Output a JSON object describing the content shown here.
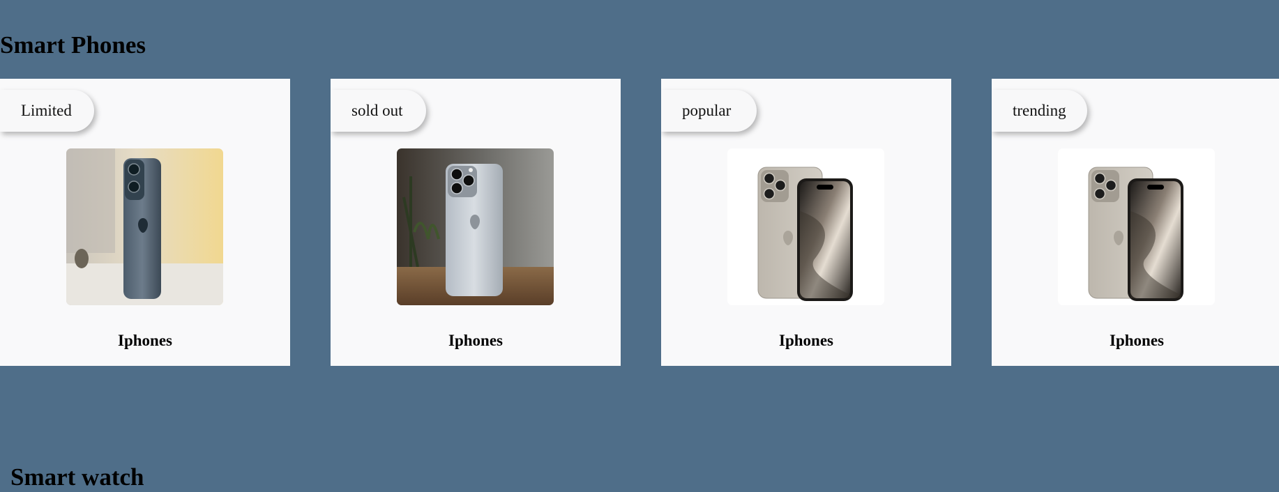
{
  "sections": {
    "phones_title": "Smart Phones",
    "watch_title": "Smart watch"
  },
  "cards": [
    {
      "badge": "Limited",
      "label": "Iphones",
      "image": "iphone-blue-photo"
    },
    {
      "badge": "sold out",
      "label": "Iphones",
      "image": "iphone-silver-photo"
    },
    {
      "badge": "popular",
      "label": "Iphones",
      "image": "iphone-natural-titanium-pair"
    },
    {
      "badge": "trending",
      "label": "Iphones",
      "image": "iphone-natural-titanium-pair"
    }
  ],
  "colors": {
    "page_background": "#4f6e89",
    "card_background": "#f9f9fa",
    "text": "#000000"
  }
}
